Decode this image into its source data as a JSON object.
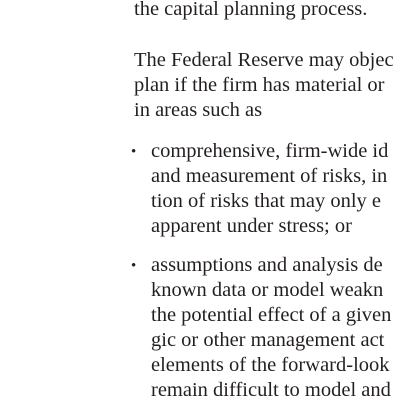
{
  "paragraph_top": {
    "lines": [
      "the capital planning process."
    ]
  },
  "paragraph_main": {
    "lines": [
      "The Federal Reserve may objec",
      "plan if the firm has material or",
      "in areas such as"
    ]
  },
  "bullets": [
    {
      "marker": "•",
      "lines": [
        "comprehensive, firm-wide id",
        "and measurement of risks, in",
        "tion of risks that may only e",
        "apparent under stress; or"
      ]
    },
    {
      "marker": "•",
      "lines": [
        "assumptions and analysis de",
        "known data or model weakn",
        "the potential effect of a given",
        "gic or other management act",
        "elements of the forward-look",
        "remain difficult to model and"
      ]
    }
  ]
}
